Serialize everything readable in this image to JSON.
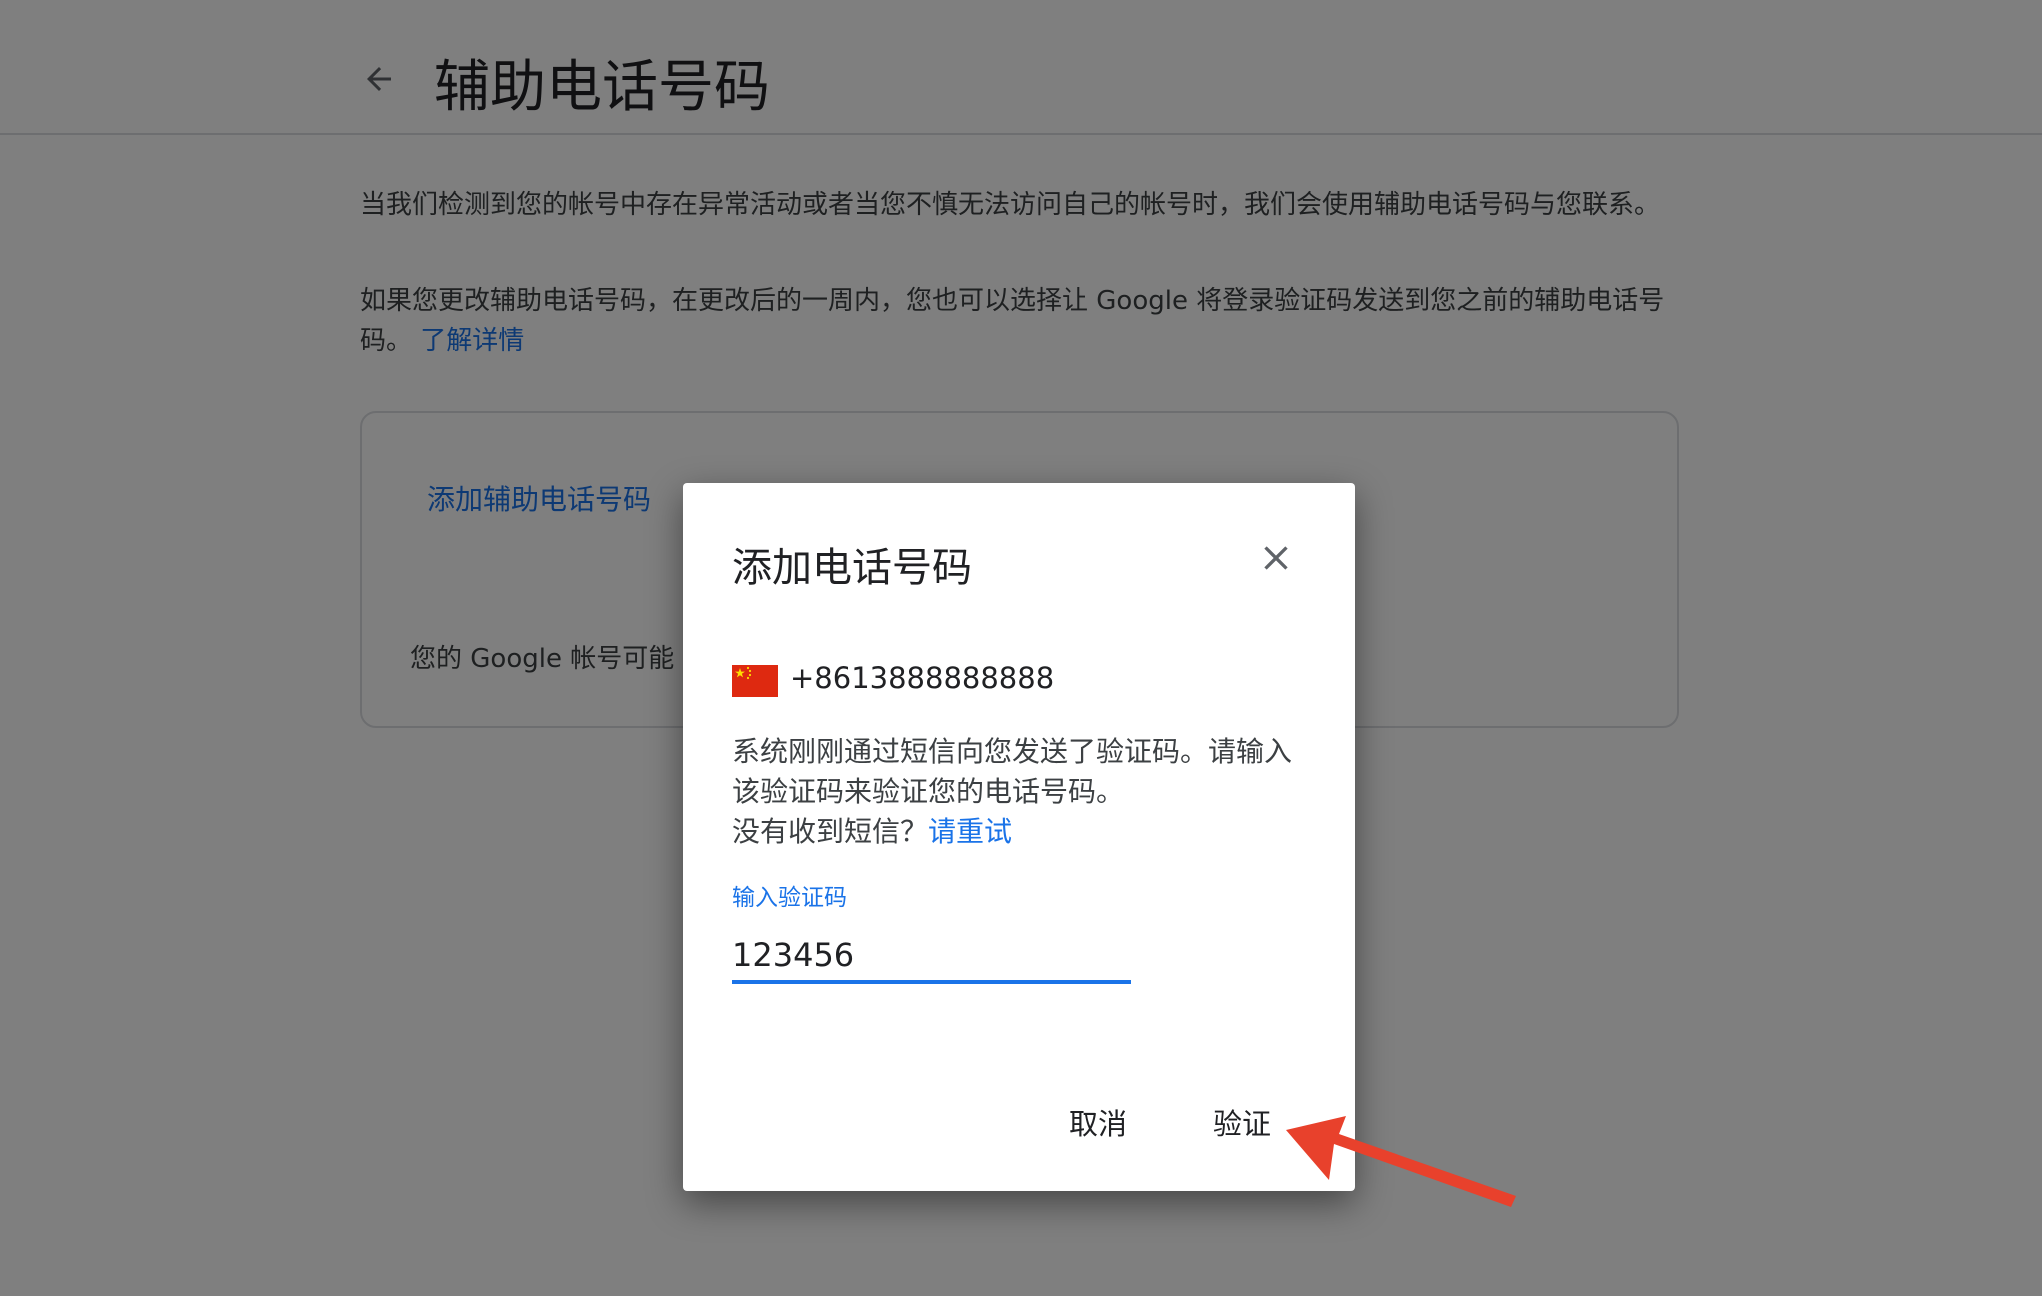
{
  "page": {
    "title": "辅助电话号码",
    "description_1": "当我们检测到您的帐号中存在异常活动或者当您不慎无法访问自己的帐号时，我们会使用辅助电话号码与您联系。",
    "description_2": "如果您更改辅助电话号码，在更改后的一周内，您也可以选择让 Google 将登录验证码发送到您之前的辅助电话号码。",
    "learn_more_link": "了解详情"
  },
  "card": {
    "add_link": "添加辅助电话号码",
    "note_prefix": "您的 Google 帐号可能"
  },
  "dialog": {
    "title": "添加电话号码",
    "close_icon": "close-icon",
    "flag_icon": "china-flag-icon",
    "phone_number": "+8613888888888",
    "message": "系统刚刚通过短信向您发送了验证码。请输入该验证码来验证您的电话号码。",
    "not_received_prefix": "没有收到短信？",
    "retry_link": "请重试",
    "input_label": "输入验证码",
    "code_value": "123456",
    "cancel_label": "取消",
    "verify_label": "验证"
  },
  "colors": {
    "link_blue": "#1a73e8",
    "overlay": "rgba(0,0,0,0.5)",
    "arrow_red": "#e8412c"
  }
}
